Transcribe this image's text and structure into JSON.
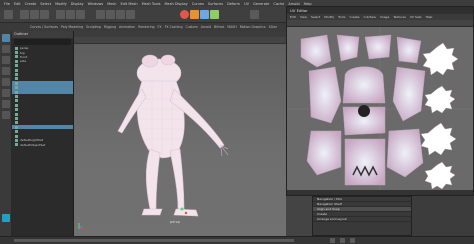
{
  "app": {
    "menus": [
      "File",
      "Edit",
      "Create",
      "Select",
      "Modify",
      "Display",
      "Windows",
      "Mesh",
      "Edit Mesh",
      "Mesh Tools",
      "Mesh Display",
      "Curves",
      "Surfaces",
      "Deform",
      "UV",
      "Generate",
      "Cache",
      "Arnold",
      "Help"
    ],
    "shelf_tabs": [
      "Curves / Surfaces",
      "Poly Modeling",
      "Sculpting",
      "Rigging",
      "Animation",
      "Rendering",
      "FX",
      "FX Caching",
      "Custom",
      "Arnold",
      "Bifrost",
      "MASH",
      "Motion Graphics",
      "XGen"
    ]
  },
  "outliner": {
    "title": "Outliner",
    "rows": [
      {
        "label": "persp",
        "selected": false
      },
      {
        "label": "top",
        "selected": false
      },
      {
        "label": "front",
        "selected": false
      },
      {
        "label": "side",
        "selected": false
      },
      {
        "label": "",
        "selected": false
      },
      {
        "label": "",
        "selected": false
      },
      {
        "label": "",
        "selected": false
      },
      {
        "label": "",
        "selected": false
      },
      {
        "label": "",
        "selected": true
      },
      {
        "label": "",
        "selected": true
      },
      {
        "label": "",
        "selected": true
      },
      {
        "label": "",
        "selected": false
      },
      {
        "label": "",
        "selected": false
      },
      {
        "label": "",
        "selected": false
      },
      {
        "label": "",
        "selected": false
      },
      {
        "label": "",
        "selected": false
      },
      {
        "label": "",
        "selected": false
      },
      {
        "label": "",
        "selected": false
      },
      {
        "label": "",
        "selected": true
      },
      {
        "label": "",
        "selected": false
      },
      {
        "label": "",
        "selected": false
      },
      {
        "label": "defaultLightSet",
        "selected": false
      },
      {
        "label": "defaultObjectSet",
        "selected": false
      }
    ]
  },
  "viewport": {
    "camera_label": "persp"
  },
  "uv_editor": {
    "title": "UV Editor",
    "menus": [
      "Edit",
      "View",
      "Select",
      "Modify",
      "Tools",
      "Create",
      "Cut/Sew",
      "Image",
      "Textures",
      "UV Sets",
      "Help"
    ]
  },
  "tool_panel": {
    "rows": [
      "Navigation / Pick",
      "Navigation Shelf",
      "Align and Snap",
      "Create",
      "Arrange and Layout"
    ]
  },
  "colors": {
    "selection": "#5285a6",
    "uv_shell": "#e9eaf4",
    "uv_gradient": "#c7a6c2",
    "maya_accent": "#21a0c4"
  }
}
